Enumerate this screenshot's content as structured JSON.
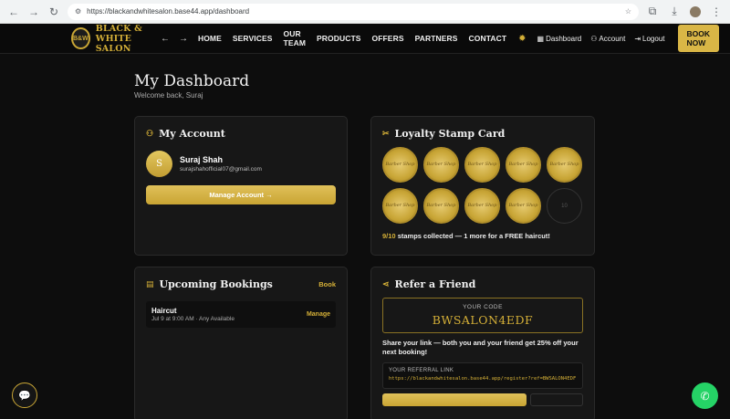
{
  "browser": {
    "url": "https://blackandwhitesalon.base44.app/dashboard"
  },
  "header": {
    "logo_text": "B&W",
    "brand": "BLACK & WHITE SALON",
    "nav": [
      "HOME",
      "SERVICES",
      "OUR TEAM",
      "PRODUCTS",
      "OFFERS",
      "PARTNERS",
      "CONTACT"
    ],
    "dashboard": "Dashboard",
    "account": "Account",
    "logout": "Logout",
    "book_now": "BOOK NOW"
  },
  "page": {
    "title": "My Dashboard",
    "welcome": "Welcome back, Suraj"
  },
  "account": {
    "heading": "My Account",
    "initial": "S",
    "name": "Suraj Shah",
    "email": "surajshahofficial07@gmail.com",
    "manage_button": "Manage Account →"
  },
  "loyalty": {
    "heading": "Loyalty Stamp Card",
    "stamp_label": "Barber Shop",
    "empty_label": "10",
    "collected": 9,
    "total": 10,
    "count_text": "9/10",
    "status_text": " stamps collected — 1 more for a FREE haircut!"
  },
  "bookings": {
    "heading": "Upcoming Bookings",
    "book_link": "Book",
    "items": [
      {
        "service": "Haircut",
        "detail": "Jul 9 at 9:00 AM · Any Available",
        "action": "Manage"
      }
    ]
  },
  "referral": {
    "heading": "Refer a Friend",
    "code_label": "YOUR CODE",
    "code": "BWSALON4EDF",
    "share_text": "Share your link — both you and your friend get 25% off your next booking!",
    "link_label": "YOUR REFERRAL LINK",
    "link": "https://blackandwhitesalon.base44.app/register?ref=BWSALON4EDF"
  },
  "colors": {
    "gold": "#d4af37",
    "background": "#0d0d0d",
    "whatsapp": "#25d366"
  }
}
